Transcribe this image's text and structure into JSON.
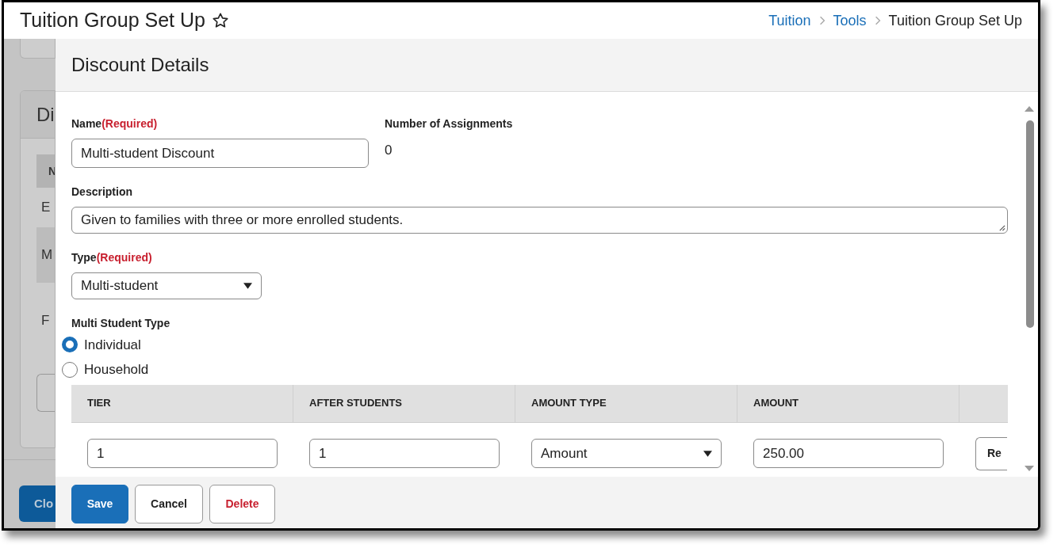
{
  "page": {
    "title": "Tuition Group Set Up",
    "breadcrumbs": [
      {
        "label": "Tuition",
        "kind": "link"
      },
      {
        "label": "Tools",
        "kind": "link"
      },
      {
        "label": "Tuition Group Set Up",
        "kind": "current"
      }
    ]
  },
  "background": {
    "card_title": "Di",
    "table_header": "N",
    "rows": [
      {
        "text": "E",
        "shaded": false
      },
      {
        "text": "M",
        "shaded": true
      },
      {
        "text": "F",
        "shaded": false
      }
    ],
    "close_button": "Clo"
  },
  "panel": {
    "title": "Discount Details",
    "name": {
      "label": "Name",
      "required": "(Required)",
      "value": "Multi-student Discount"
    },
    "assignments": {
      "label": "Number of Assignments",
      "value": "0"
    },
    "description": {
      "label": "Description",
      "value": "Given to families with three or more enrolled students."
    },
    "type": {
      "label": "Type",
      "required": "(Required)",
      "value": "Multi-student"
    },
    "multi_student_type": {
      "label": "Multi Student Type",
      "options": [
        {
          "label": "Individual",
          "selected": true
        },
        {
          "label": "Household",
          "selected": false
        }
      ]
    },
    "tiers": {
      "columns": [
        "TIER",
        "AFTER STUDENTS",
        "AMOUNT TYPE",
        "AMOUNT"
      ],
      "rows": [
        {
          "cells": [
            {
              "kind": "input",
              "value": "1"
            },
            {
              "kind": "input",
              "value": "1"
            },
            {
              "kind": "select",
              "value": "Amount"
            },
            {
              "kind": "input",
              "value": "250.00"
            },
            {
              "kind": "button",
              "value": "Re"
            }
          ]
        }
      ]
    },
    "buttons": [
      {
        "label": "Save",
        "kind": "primary"
      },
      {
        "label": "Cancel",
        "kind": "secondary"
      },
      {
        "label": "Delete",
        "kind": "danger"
      }
    ]
  }
}
